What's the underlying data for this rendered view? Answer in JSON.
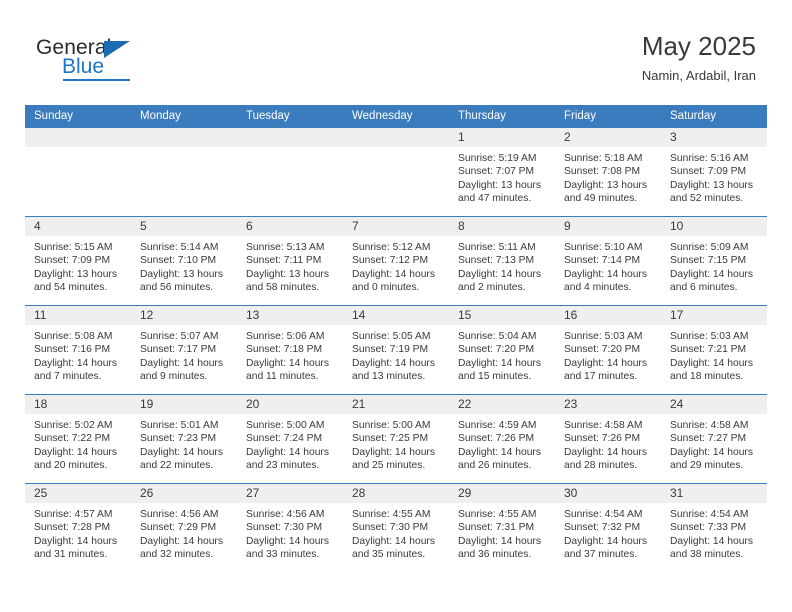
{
  "logo": {
    "general_text": "General",
    "blue_text": "Blue",
    "triangle_color": "#1c6cb5",
    "blue_color": "#1c77c9"
  },
  "header": {
    "month_title": "May 2025",
    "location": "Namin, Ardabil, Iran",
    "header_bg": "#3b7cbe",
    "daynum_bg": "#efefef"
  },
  "weekday_headers": [
    "Sunday",
    "Monday",
    "Tuesday",
    "Wednesday",
    "Thursday",
    "Friday",
    "Saturday"
  ],
  "weeks": [
    [
      {
        "day": "",
        "sunrise": "",
        "sunset": "",
        "daylight_line1": "",
        "daylight_line2": ""
      },
      {
        "day": "",
        "sunrise": "",
        "sunset": "",
        "daylight_line1": "",
        "daylight_line2": ""
      },
      {
        "day": "",
        "sunrise": "",
        "sunset": "",
        "daylight_line1": "",
        "daylight_line2": ""
      },
      {
        "day": "",
        "sunrise": "",
        "sunset": "",
        "daylight_line1": "",
        "daylight_line2": ""
      },
      {
        "day": "1",
        "sunrise": "Sunrise: 5:19 AM",
        "sunset": "Sunset: 7:07 PM",
        "daylight_line1": "Daylight: 13 hours",
        "daylight_line2": "and 47 minutes."
      },
      {
        "day": "2",
        "sunrise": "Sunrise: 5:18 AM",
        "sunset": "Sunset: 7:08 PM",
        "daylight_line1": "Daylight: 13 hours",
        "daylight_line2": "and 49 minutes."
      },
      {
        "day": "3",
        "sunrise": "Sunrise: 5:16 AM",
        "sunset": "Sunset: 7:09 PM",
        "daylight_line1": "Daylight: 13 hours",
        "daylight_line2": "and 52 minutes."
      }
    ],
    [
      {
        "day": "4",
        "sunrise": "Sunrise: 5:15 AM",
        "sunset": "Sunset: 7:09 PM",
        "daylight_line1": "Daylight: 13 hours",
        "daylight_line2": "and 54 minutes."
      },
      {
        "day": "5",
        "sunrise": "Sunrise: 5:14 AM",
        "sunset": "Sunset: 7:10 PM",
        "daylight_line1": "Daylight: 13 hours",
        "daylight_line2": "and 56 minutes."
      },
      {
        "day": "6",
        "sunrise": "Sunrise: 5:13 AM",
        "sunset": "Sunset: 7:11 PM",
        "daylight_line1": "Daylight: 13 hours",
        "daylight_line2": "and 58 minutes."
      },
      {
        "day": "7",
        "sunrise": "Sunrise: 5:12 AM",
        "sunset": "Sunset: 7:12 PM",
        "daylight_line1": "Daylight: 14 hours",
        "daylight_line2": "and 0 minutes."
      },
      {
        "day": "8",
        "sunrise": "Sunrise: 5:11 AM",
        "sunset": "Sunset: 7:13 PM",
        "daylight_line1": "Daylight: 14 hours",
        "daylight_line2": "and 2 minutes."
      },
      {
        "day": "9",
        "sunrise": "Sunrise: 5:10 AM",
        "sunset": "Sunset: 7:14 PM",
        "daylight_line1": "Daylight: 14 hours",
        "daylight_line2": "and 4 minutes."
      },
      {
        "day": "10",
        "sunrise": "Sunrise: 5:09 AM",
        "sunset": "Sunset: 7:15 PM",
        "daylight_line1": "Daylight: 14 hours",
        "daylight_line2": "and 6 minutes."
      }
    ],
    [
      {
        "day": "11",
        "sunrise": "Sunrise: 5:08 AM",
        "sunset": "Sunset: 7:16 PM",
        "daylight_line1": "Daylight: 14 hours",
        "daylight_line2": "and 7 minutes."
      },
      {
        "day": "12",
        "sunrise": "Sunrise: 5:07 AM",
        "sunset": "Sunset: 7:17 PM",
        "daylight_line1": "Daylight: 14 hours",
        "daylight_line2": "and 9 minutes."
      },
      {
        "day": "13",
        "sunrise": "Sunrise: 5:06 AM",
        "sunset": "Sunset: 7:18 PM",
        "daylight_line1": "Daylight: 14 hours",
        "daylight_line2": "and 11 minutes."
      },
      {
        "day": "14",
        "sunrise": "Sunrise: 5:05 AM",
        "sunset": "Sunset: 7:19 PM",
        "daylight_line1": "Daylight: 14 hours",
        "daylight_line2": "and 13 minutes."
      },
      {
        "day": "15",
        "sunrise": "Sunrise: 5:04 AM",
        "sunset": "Sunset: 7:20 PM",
        "daylight_line1": "Daylight: 14 hours",
        "daylight_line2": "and 15 minutes."
      },
      {
        "day": "16",
        "sunrise": "Sunrise: 5:03 AM",
        "sunset": "Sunset: 7:20 PM",
        "daylight_line1": "Daylight: 14 hours",
        "daylight_line2": "and 17 minutes."
      },
      {
        "day": "17",
        "sunrise": "Sunrise: 5:03 AM",
        "sunset": "Sunset: 7:21 PM",
        "daylight_line1": "Daylight: 14 hours",
        "daylight_line2": "and 18 minutes."
      }
    ],
    [
      {
        "day": "18",
        "sunrise": "Sunrise: 5:02 AM",
        "sunset": "Sunset: 7:22 PM",
        "daylight_line1": "Daylight: 14 hours",
        "daylight_line2": "and 20 minutes."
      },
      {
        "day": "19",
        "sunrise": "Sunrise: 5:01 AM",
        "sunset": "Sunset: 7:23 PM",
        "daylight_line1": "Daylight: 14 hours",
        "daylight_line2": "and 22 minutes."
      },
      {
        "day": "20",
        "sunrise": "Sunrise: 5:00 AM",
        "sunset": "Sunset: 7:24 PM",
        "daylight_line1": "Daylight: 14 hours",
        "daylight_line2": "and 23 minutes."
      },
      {
        "day": "21",
        "sunrise": "Sunrise: 5:00 AM",
        "sunset": "Sunset: 7:25 PM",
        "daylight_line1": "Daylight: 14 hours",
        "daylight_line2": "and 25 minutes."
      },
      {
        "day": "22",
        "sunrise": "Sunrise: 4:59 AM",
        "sunset": "Sunset: 7:26 PM",
        "daylight_line1": "Daylight: 14 hours",
        "daylight_line2": "and 26 minutes."
      },
      {
        "day": "23",
        "sunrise": "Sunrise: 4:58 AM",
        "sunset": "Sunset: 7:26 PM",
        "daylight_line1": "Daylight: 14 hours",
        "daylight_line2": "and 28 minutes."
      },
      {
        "day": "24",
        "sunrise": "Sunrise: 4:58 AM",
        "sunset": "Sunset: 7:27 PM",
        "daylight_line1": "Daylight: 14 hours",
        "daylight_line2": "and 29 minutes."
      }
    ],
    [
      {
        "day": "25",
        "sunrise": "Sunrise: 4:57 AM",
        "sunset": "Sunset: 7:28 PM",
        "daylight_line1": "Daylight: 14 hours",
        "daylight_line2": "and 31 minutes."
      },
      {
        "day": "26",
        "sunrise": "Sunrise: 4:56 AM",
        "sunset": "Sunset: 7:29 PM",
        "daylight_line1": "Daylight: 14 hours",
        "daylight_line2": "and 32 minutes."
      },
      {
        "day": "27",
        "sunrise": "Sunrise: 4:56 AM",
        "sunset": "Sunset: 7:30 PM",
        "daylight_line1": "Daylight: 14 hours",
        "daylight_line2": "and 33 minutes."
      },
      {
        "day": "28",
        "sunrise": "Sunrise: 4:55 AM",
        "sunset": "Sunset: 7:30 PM",
        "daylight_line1": "Daylight: 14 hours",
        "daylight_line2": "and 35 minutes."
      },
      {
        "day": "29",
        "sunrise": "Sunrise: 4:55 AM",
        "sunset": "Sunset: 7:31 PM",
        "daylight_line1": "Daylight: 14 hours",
        "daylight_line2": "and 36 minutes."
      },
      {
        "day": "30",
        "sunrise": "Sunrise: 4:54 AM",
        "sunset": "Sunset: 7:32 PM",
        "daylight_line1": "Daylight: 14 hours",
        "daylight_line2": "and 37 minutes."
      },
      {
        "day": "31",
        "sunrise": "Sunrise: 4:54 AM",
        "sunset": "Sunset: 7:33 PM",
        "daylight_line1": "Daylight: 14 hours",
        "daylight_line2": "and 38 minutes."
      }
    ]
  ]
}
